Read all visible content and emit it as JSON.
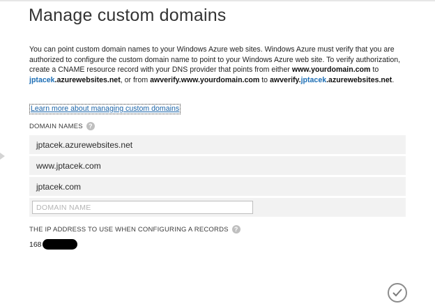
{
  "dialog": {
    "title": "Manage custom domains",
    "description": {
      "part1": "You can point custom domain names to your Windows Azure web sites. Windows Azure must verify that you are authorized to configure the custom domain name to point to your Windows Azure web site. To verify authorization, create a CNAME resource record with your DNS provider that points from either ",
      "domain_example": "www.yourdomain.com",
      "to1": " to ",
      "target1_highlight": "jptacek",
      "target1_suffix": ".azurewebsites.net",
      "or_from": ", or from ",
      "verify_example": "awverify.www.yourdomain.com",
      "to2": " to ",
      "target2_prefix": "awverify.",
      "target2_highlight": "jptacek",
      "target2_suffix": ".azurewebsites.net",
      "period": "."
    },
    "learn_more_link": "Learn more about managing custom domains",
    "domain_names_label": "DOMAIN NAMES",
    "domain_names": [
      "jptacek.azurewebsites.net",
      "www.jptacek.com",
      "jptacek.com"
    ],
    "domain_input_placeholder": "DOMAIN NAME",
    "ip_label": "THE IP ADDRESS TO USE WHEN CONFIGURING A RECORDS",
    "ip_value_visible": "168",
    "help_icon_glyph": "?",
    "confirm_icon": "checkmark-icon"
  },
  "colors": {
    "link": "#1b64a8",
    "highlight": "#1e6fb5",
    "row_background": "#f2f2f2",
    "help_icon": "#bfbfbf"
  }
}
